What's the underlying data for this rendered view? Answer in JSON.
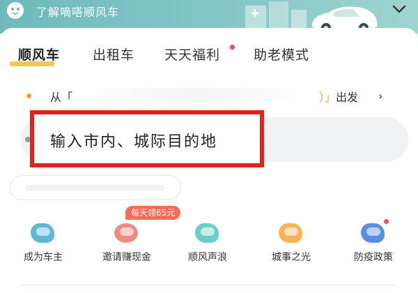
{
  "banner": {
    "title": "了解嘀嗒顺风车"
  },
  "tabs": [
    {
      "label": "顺风车",
      "active": true
    },
    {
      "label": "出租车",
      "active": false
    },
    {
      "label": "天天福利",
      "active": false,
      "has_dot": true
    },
    {
      "label": "助老模式",
      "active": false
    }
  ],
  "route": {
    "from_prefix": "从「",
    "from_suffix": "）」",
    "depart_label": "出发",
    "depart_chevron": "›"
  },
  "destination": {
    "placeholder": "输入市内、城际目的地"
  },
  "promo_badge": "每天领65元",
  "services": [
    {
      "label": "成为车主",
      "icon": "car-owner-icon",
      "color": "#5fb8d6"
    },
    {
      "label": "邀请赚现金",
      "icon": "invite-cash-icon",
      "color": "#f08a80"
    },
    {
      "label": "顺风声浪",
      "icon": "sound-wave-icon",
      "color": "#6ccfc6"
    },
    {
      "label": "城事之光",
      "icon": "city-light-icon",
      "color": "#f7b25a"
    },
    {
      "label": "防疫政策",
      "icon": "epidemic-policy-icon",
      "color": "#5a8ee0",
      "has_dot": true
    }
  ],
  "colors": {
    "accent_yellow": "#f7c74c",
    "highlight_red": "#e4211c",
    "banner_teal": "#6fb9bc"
  }
}
